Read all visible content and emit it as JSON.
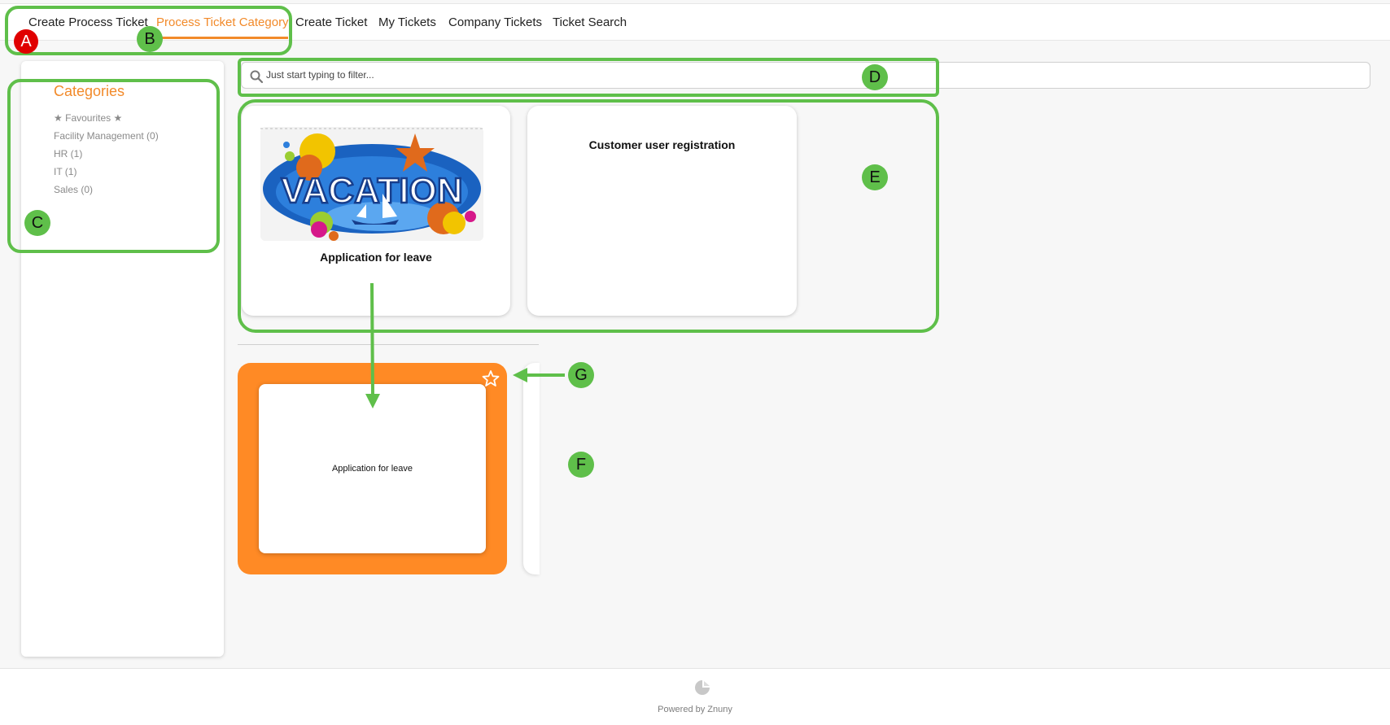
{
  "nav": {
    "items": [
      {
        "label": "Create Process Ticket",
        "active": false
      },
      {
        "label": "Process Ticket Category",
        "active": true
      },
      {
        "label": "Create Ticket",
        "active": false
      },
      {
        "label": "My Tickets",
        "active": false
      },
      {
        "label": "Company Tickets",
        "active": false
      },
      {
        "label": "Ticket Search",
        "active": false
      }
    ]
  },
  "sidebar": {
    "heading": "Categories",
    "items": [
      {
        "label": "Favourites"
      },
      {
        "label": "Facility Management (0)"
      },
      {
        "label": "HR (1)"
      },
      {
        "label": "IT (1)"
      },
      {
        "label": "Sales (0)"
      }
    ]
  },
  "filter": {
    "placeholder": "Just start typing to filter...",
    "icon": "search-icon"
  },
  "cards": [
    {
      "title": "Application for leave",
      "image": "vacation-image",
      "image_text": "VACATION"
    },
    {
      "title": "Customer user registration"
    }
  ],
  "zoom_card": {
    "title": "Application for leave",
    "icon": "star-outline-icon"
  },
  "footer": {
    "text": "Powered by Znuny"
  },
  "annotations": {
    "markers": [
      "A",
      "B",
      "C",
      "D",
      "E",
      "F",
      "G"
    ]
  },
  "colors": {
    "accent": "#f28a2a",
    "highlight": "#ff8a25",
    "annotation_green": "#5fbf4a",
    "annotation_red": "#e00000"
  }
}
